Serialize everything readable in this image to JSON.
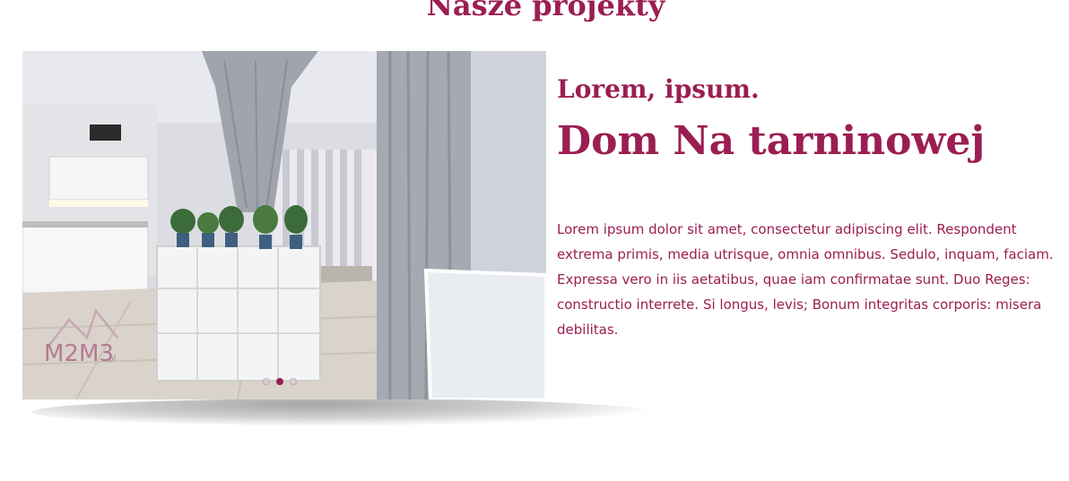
{
  "section": {
    "title": "Nasze projekty"
  },
  "slider": {
    "logo_text": "M2M3",
    "logo_suffix": "pl",
    "dots": [
      {
        "active": false
      },
      {
        "active": true
      },
      {
        "active": false
      }
    ],
    "active_index": 2,
    "total": 3
  },
  "project": {
    "subtitle": "Lorem, ipsum.",
    "title": "Dom Na tarninowej",
    "description": "Lorem ipsum dolor sit amet, consectetur adipiscing elit. Respondent extrema primis, media utrisque, omnia omnibus. Sedulo, inquam, faciam. Expressa vero in iis aetatibus, quae iam confirmatae sunt. Duo Reges: constructio interrete. Si longus, levis; Bonum integritas corporis: misera debilitas."
  },
  "colors": {
    "brand": "#9b1e52",
    "background": "#ffffff"
  }
}
